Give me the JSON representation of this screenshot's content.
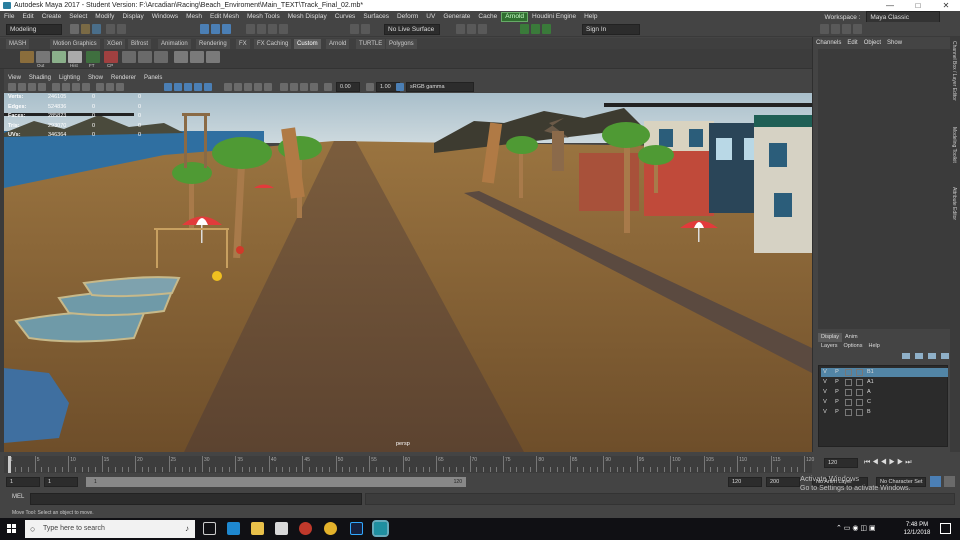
{
  "window": {
    "title": "Autodesk Maya 2017 - Student Version: F:\\Arcadian\\Racing\\Beach_Enviroment\\Main_TEXT\\Track_Final_02.mb*",
    "min": "—",
    "max": "□",
    "close": "✕"
  },
  "menubar": {
    "items": [
      "File",
      "Edit",
      "Create",
      "Select",
      "Modify",
      "Display",
      "Windows",
      "Mesh",
      "Edit Mesh",
      "Mesh Tools",
      "Mesh Display",
      "Curves",
      "Surfaces",
      "Deform",
      "UV",
      "Generate",
      "Cache"
    ],
    "arnold": "Arnold",
    "items_after": [
      "Houdini Engine",
      "Help"
    ],
    "workspace_label": "Workspace :",
    "workspace_value": "Maya Classic"
  },
  "statusline": {
    "mode": "Modeling",
    "live_surface": "No Live Surface",
    "sign_in": "Sign In"
  },
  "shelf": {
    "tabs": [
      "MASH",
      "Motion Graphics",
      "XGen",
      "Bifrost",
      "Animation",
      "Rendering",
      "FX",
      "FX Caching",
      "Custom",
      "Arnold",
      "TURTLE",
      "Polygons"
    ],
    "active_tab": "Custom",
    "icon_labels": [
      "Out",
      "Hist",
      "FT",
      "CP"
    ]
  },
  "panel_menu": [
    "View",
    "Shading",
    "Lighting",
    "Show",
    "Renderer",
    "Panels"
  ],
  "panel_toolbar": {
    "exposure": "0.00",
    "gamma": "1.00",
    "color_space": "sRGB gamma"
  },
  "hud": {
    "rows": [
      {
        "k": "Verts:",
        "v1": "246105",
        "v2": "0",
        "v3": "0"
      },
      {
        "k": "Edges:",
        "v1": "524836",
        "v2": "0",
        "v3": "0"
      },
      {
        "k": "Faces:",
        "v1": "285823",
        "v2": "0",
        "v3": "0"
      },
      {
        "k": "Tris:",
        "v1": "293070",
        "v2": "0",
        "v3": "0"
      },
      {
        "k": "UVs:",
        "v1": "346364",
        "v2": "0",
        "v3": "0"
      }
    ]
  },
  "viewport": {
    "camera": "persp",
    "colors": {
      "sky": "#b6c9d4",
      "sand": "#8a6537",
      "road": "#6b4f35",
      "water": "#2f6fa1"
    }
  },
  "channelbox": {
    "tabs": [
      "Channels",
      "Edit",
      "Object",
      "Show"
    ]
  },
  "sidebar_vertical": [
    "Channel Box / Layer Editor",
    "Modeling Toolkit",
    "Attribute Editor"
  ],
  "layer_editor": {
    "tabs": [
      "Display",
      "Anim"
    ],
    "active_tab": "Display",
    "menu": [
      "Layers",
      "Options",
      "Help"
    ],
    "layers": [
      {
        "v": "V",
        "p": "P",
        "name": "B1",
        "selected": true
      },
      {
        "v": "V",
        "p": "P",
        "name": "A1",
        "selected": false
      },
      {
        "v": "V",
        "p": "P",
        "name": "A",
        "selected": false
      },
      {
        "v": "V",
        "p": "P",
        "name": "C",
        "selected": false
      },
      {
        "v": "V",
        "p": "P",
        "name": "B",
        "selected": false
      }
    ]
  },
  "timeline": {
    "ticks": [
      "1",
      "5",
      "10",
      "15",
      "20",
      "25",
      "30",
      "35",
      "40",
      "45",
      "50",
      "55",
      "60",
      "65",
      "70",
      "75",
      "80",
      "85",
      "90",
      "95",
      "100",
      "105",
      "110",
      "115",
      "120"
    ],
    "current": "1",
    "end_label": "120"
  },
  "range": {
    "start": "1",
    "start_inner": "1",
    "bar_start": "1",
    "bar_end": "120",
    "end_inner": "120",
    "end": "200",
    "anim_layer": "No Anim Layer",
    "char_set": "No Character Set"
  },
  "cmdline": {
    "lang": "MEL"
  },
  "helpline": "Move Tool: Select an object to move.",
  "watermark": {
    "line1": "Activate Windows",
    "line2": "Go to Settings to activate Windows."
  },
  "taskbar": {
    "search_placeholder": "Type here to search",
    "time": "7:48 PM",
    "date": "12/1/2018"
  }
}
